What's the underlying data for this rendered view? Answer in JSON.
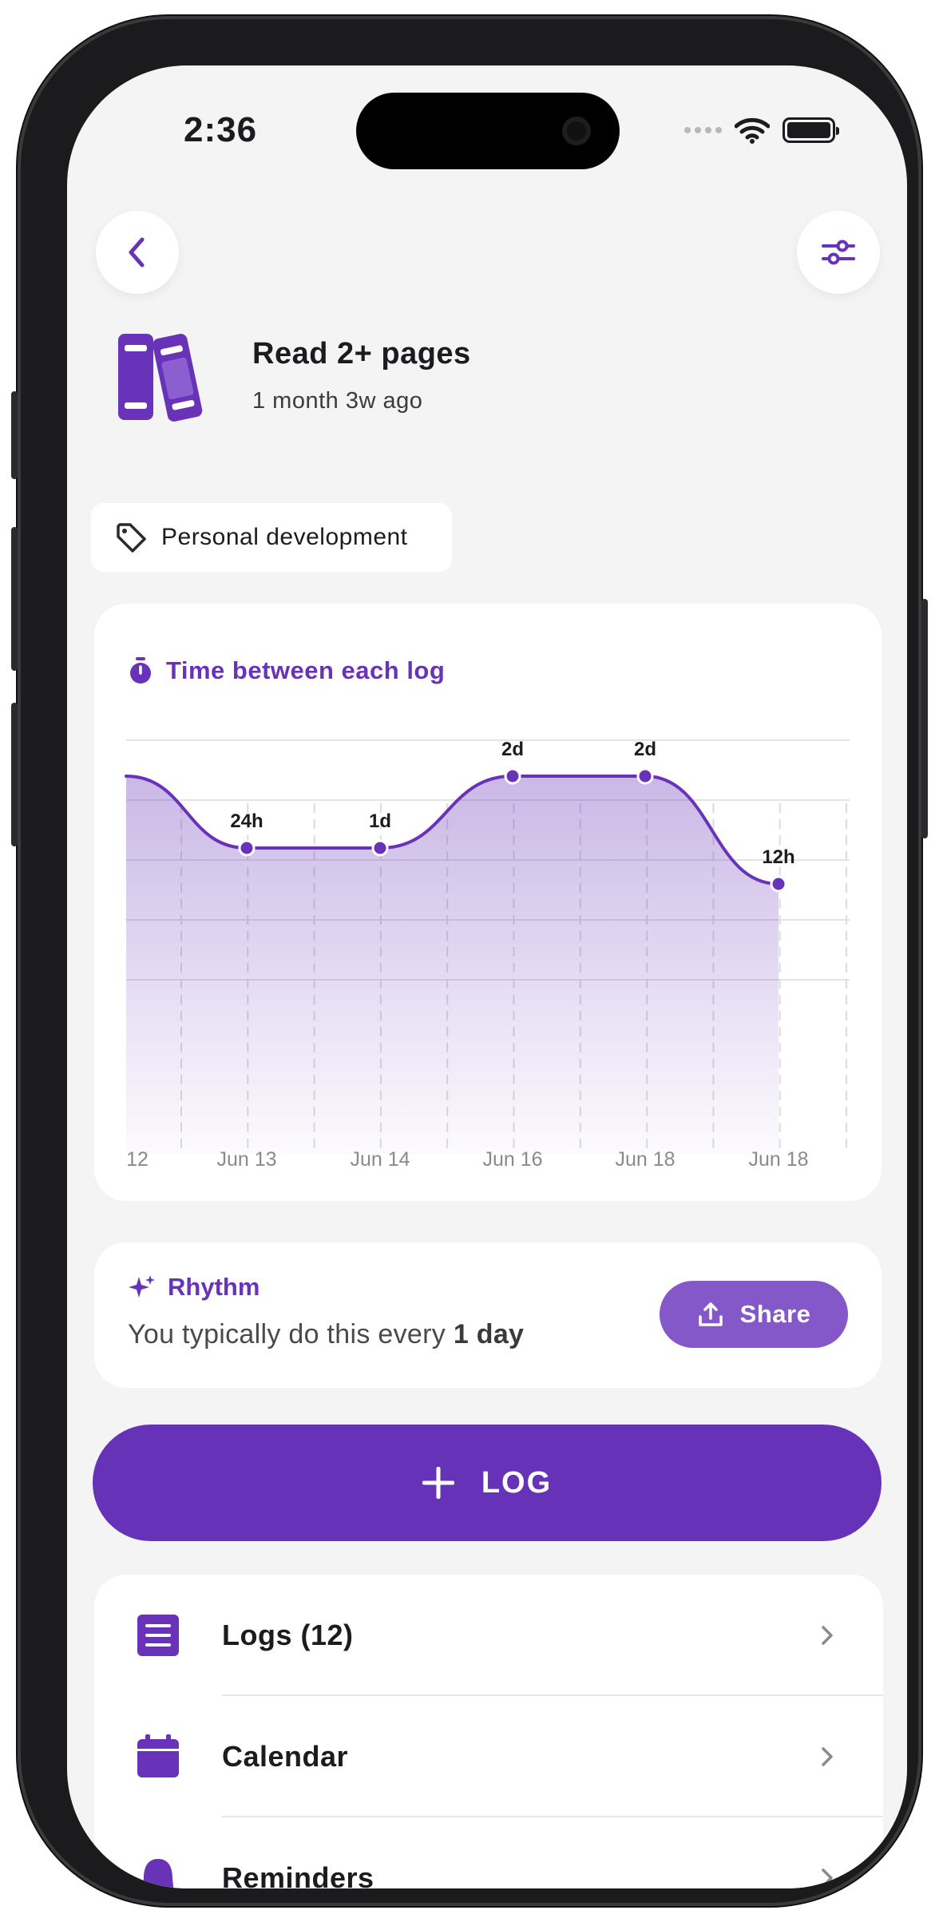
{
  "status_bar": {
    "time": "2:36"
  },
  "header": {
    "back_icon": "chevron-left-icon",
    "filter_icon": "sliders-icon"
  },
  "habit": {
    "icon": "books-icon",
    "title": "Read 2+ pages",
    "subtitle": "1 month 3w ago"
  },
  "tag": {
    "icon": "tag-icon",
    "label": "Personal development"
  },
  "chart_card": {
    "icon": "timer-icon",
    "title": "Time between each log"
  },
  "chart_data": {
    "type": "line",
    "categories": [
      "12",
      "Jun 13",
      "Jun 14",
      "Jun 16",
      "Jun 18",
      "Jun 18"
    ],
    "series": [
      {
        "values": [
          2,
          1,
          1,
          2,
          2,
          0.5
        ],
        "point_labels": [
          "",
          "24h",
          "1d",
          "2d",
          "2d",
          "12h"
        ]
      }
    ],
    "grid": true,
    "accent": "#6833b8"
  },
  "rhythm": {
    "icon": "sparkle-icon",
    "title": "Rhythm",
    "text_prefix": "You typically do this every ",
    "text_value": "1 day",
    "share_label": "Share",
    "share_icon": "upload-icon"
  },
  "log_button": {
    "label": "LOG",
    "icon": "plus-icon"
  },
  "menu": {
    "items": [
      {
        "label": "Logs (12)",
        "icon": "list-icon"
      },
      {
        "label": "Calendar",
        "icon": "calendar-icon"
      },
      {
        "label": "Reminders",
        "icon": "bell-icon"
      }
    ]
  },
  "colors": {
    "accent": "#6833b8",
    "log_button": "#6633b8",
    "share_button": "#8458c8",
    "background": "#f4f4f4"
  }
}
